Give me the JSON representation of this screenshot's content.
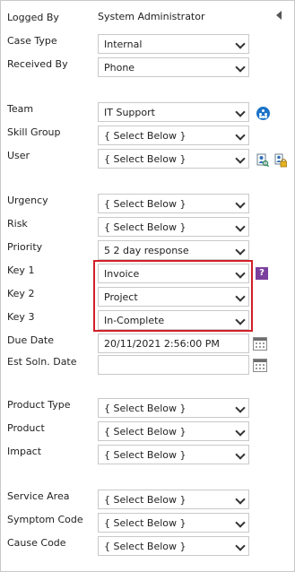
{
  "fields": {
    "logged_by": {
      "label": "Logged By",
      "value": "System Administrator"
    },
    "case_type": {
      "label": "Case Type",
      "value": "Internal"
    },
    "received_by": {
      "label": "Received By",
      "value": "Phone"
    },
    "team": {
      "label": "Team",
      "value": "IT Support"
    },
    "skill_group": {
      "label": "Skill Group",
      "value": "{ Select Below }"
    },
    "user": {
      "label": "User",
      "value": "{ Select Below }"
    },
    "urgency": {
      "label": "Urgency",
      "value": "{ Select Below }"
    },
    "risk": {
      "label": "Risk",
      "value": "{ Select Below }"
    },
    "priority": {
      "label": "Priority",
      "value": "5 2 day response"
    },
    "key1": {
      "label": "Key 1",
      "value": "Invoice"
    },
    "key2": {
      "label": "Key 2",
      "value": "Project"
    },
    "key3": {
      "label": "Key 3",
      "value": "In-Complete"
    },
    "due_date": {
      "label": "Due Date",
      "value": "20/11/2021 2:56:00 PM"
    },
    "est_soln_date": {
      "label": "Est Soln. Date",
      "value": ""
    },
    "product_type": {
      "label": "Product Type",
      "value": "{ Select Below }"
    },
    "product": {
      "label": "Product",
      "value": "{ Select Below }"
    },
    "impact": {
      "label": "Impact",
      "value": "{ Select Below }"
    },
    "service_area": {
      "label": "Service Area",
      "value": "{ Select Below }"
    },
    "symptom_code": {
      "label": "Symptom Code",
      "value": "{ Select Below }"
    },
    "cause_code": {
      "label": "Cause Code",
      "value": "{ Select Below }"
    }
  },
  "help_icon_glyph": "?",
  "colors": {
    "highlight": "#d11f2a",
    "team_icon": "#1a73c8",
    "help_icon": "#7b3f9e"
  },
  "icons": [
    "collapse-arrow-icon",
    "team-members-icon",
    "help-icon",
    "calendar-icon",
    "user-search-icon",
    "user-lock-icon"
  ]
}
